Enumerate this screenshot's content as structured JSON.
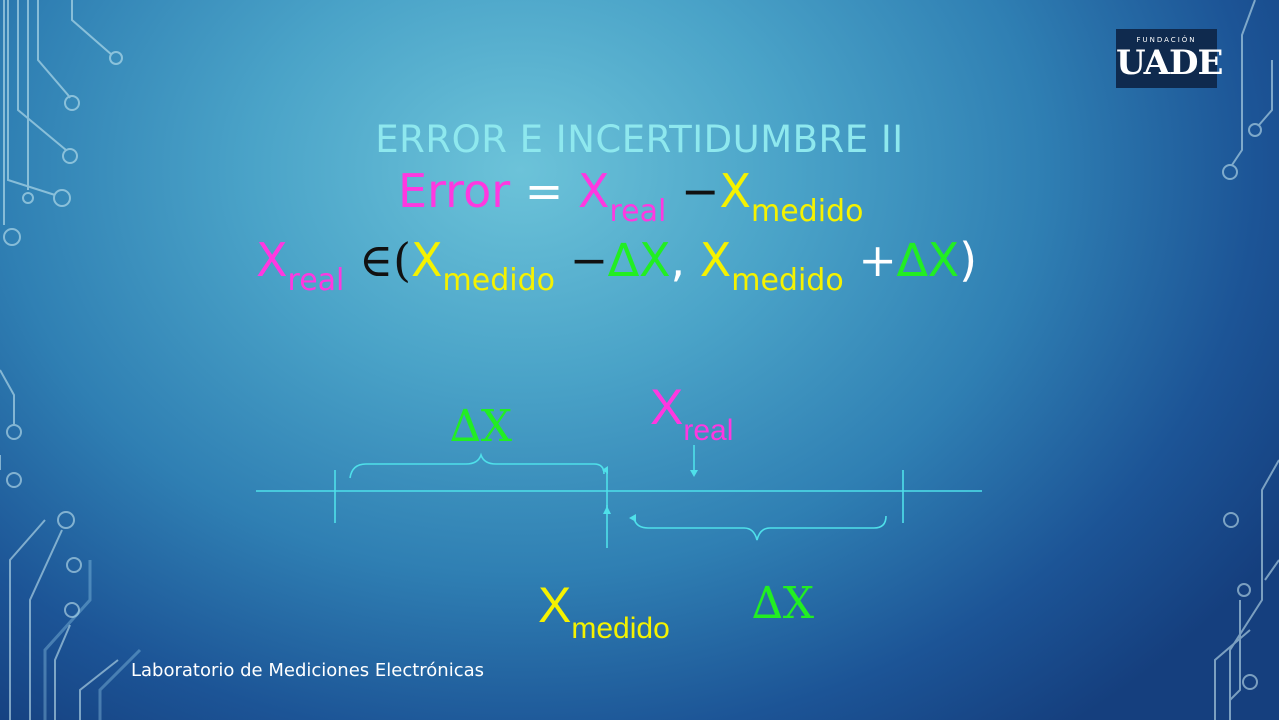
{
  "logo": {
    "top": "FUNDACIÓN",
    "main": "UADE"
  },
  "slide": {
    "title": "ERROR E INCERTIDUMBRE II",
    "footer": "Laboratorio de Mediciones Electrónicas"
  },
  "equation1": {
    "lhs": "Error",
    "equals": "=",
    "x1": "X",
    "sub1": "real",
    "minus": "−",
    "x2": "X",
    "sub2": "medido"
  },
  "equation2": {
    "x": "X",
    "sub_real": "real",
    "in": "∈",
    "open": "(",
    "x_a": "X",
    "sub_a": "medido",
    "minus": "−",
    "delta_a": "∆X",
    "comma": ",",
    "x_b": "X",
    "sub_b": "medido",
    "plus": "+",
    "delta_b": "∆X",
    "close": ")"
  },
  "diagram": {
    "delta_top": "∆X",
    "x_real": "X",
    "x_real_sub": "real",
    "x_medido": "X",
    "x_medido_sub": "medido",
    "delta_bottom": "∆X"
  },
  "colors": {
    "title": "#8ee8ee",
    "error": "#ff38e0",
    "medido": "#f5f200",
    "delta": "#22ee22",
    "lines": "#4fe0ea"
  }
}
